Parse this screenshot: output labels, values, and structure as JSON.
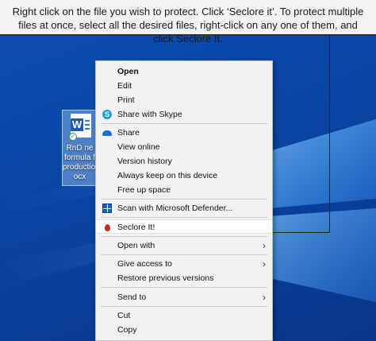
{
  "banner": {
    "text": "Right click on the file you wish to protect. Click ‘Seclore it’. To protect multiple files at once, select all the desired files, right-click on any one of them, and click Seclore It."
  },
  "desktop_file": {
    "name": "RnD new formula for production.docx",
    "display_name": "RnD ne\nformula f\nproduction\nocx",
    "icon": "word-document-icon",
    "status_icon": "synced-check-icon"
  },
  "context_menu": {
    "items": [
      {
        "label": "Open",
        "bold": true
      },
      {
        "label": "Edit"
      },
      {
        "label": "Print"
      },
      {
        "label": "Share with Skype",
        "icon": "skype-icon"
      },
      {
        "label": "Share",
        "icon": "onedrive-cloud-icon"
      },
      {
        "label": "View online"
      },
      {
        "label": "Version history"
      },
      {
        "label": "Always keep on this device"
      },
      {
        "label": "Free up space"
      },
      {
        "label": "Scan with Microsoft Defender...",
        "icon": "defender-icon"
      },
      {
        "label": "Seclore It!",
        "icon": "seclore-drop-icon",
        "highlighted": true
      },
      {
        "label": "Open with",
        "submenu": true
      },
      {
        "label": "Give access to",
        "submenu": true
      },
      {
        "label": "Restore previous versions"
      },
      {
        "label": "Send to",
        "submenu": true
      },
      {
        "label": "Cut"
      },
      {
        "label": "Copy"
      }
    ],
    "submenu_arrow": "›"
  },
  "colors": {
    "wallpaper": "#0a46a6",
    "menu_bg": "#f2f2f2",
    "banner_bg": "#f3f3f3",
    "seclore_red": "#c62b2b"
  }
}
